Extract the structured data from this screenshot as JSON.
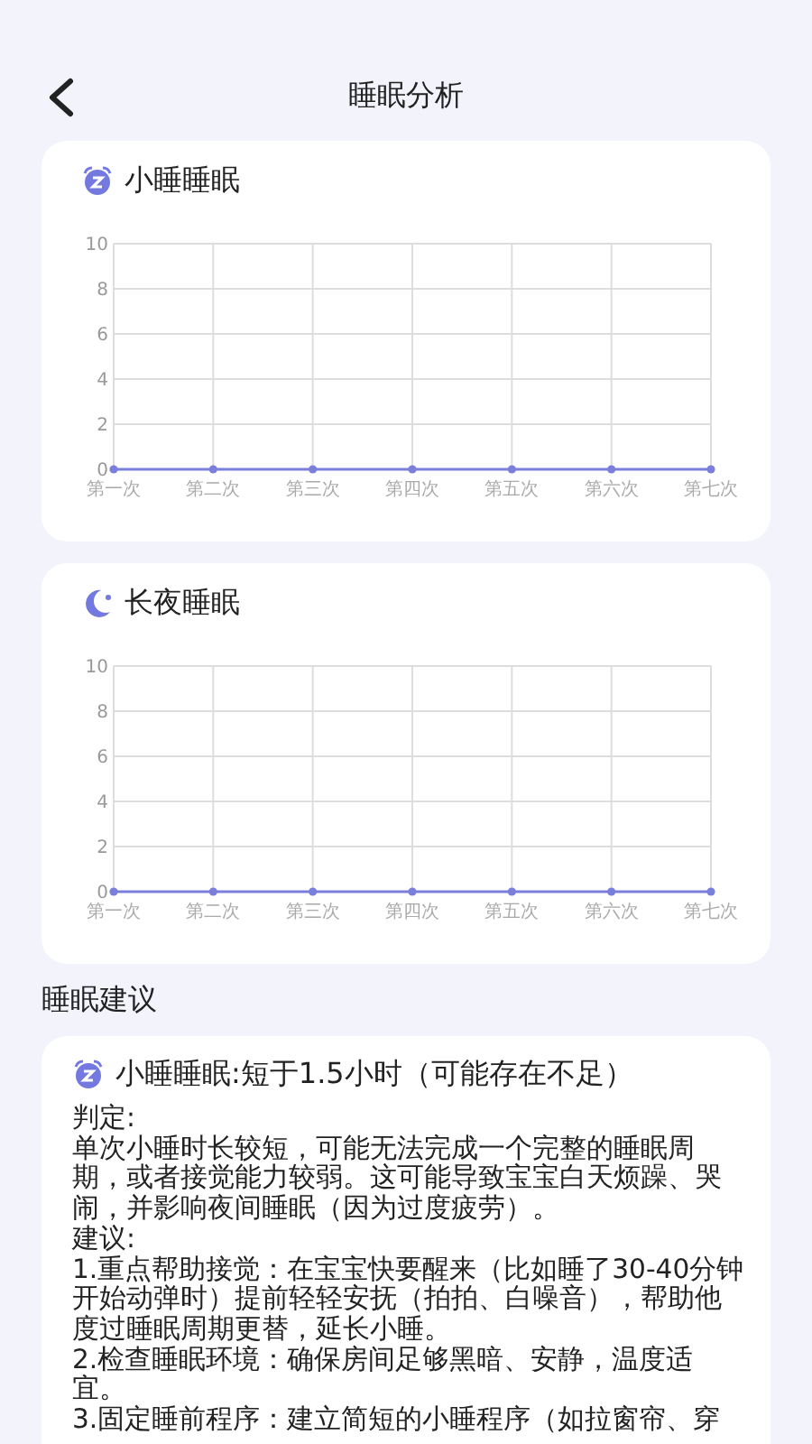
{
  "header": {
    "title": "睡眠分析"
  },
  "charts": [
    {
      "kind": "nap",
      "title": "小睡睡眠",
      "chart_data": {
        "type": "line",
        "categories": [
          "第一次",
          "第二次",
          "第三次",
          "第四次",
          "第五次",
          "第六次",
          "第七次"
        ],
        "series": [
          {
            "color": "#7b7fdc",
            "marker": true,
            "values": [
              0,
              0,
              0,
              0,
              0,
              0,
              0
            ]
          }
        ],
        "grid": true,
        "ylim": [
          0,
          10
        ],
        "yticks": [
          0,
          2,
          4,
          6,
          8,
          10
        ]
      }
    },
    {
      "kind": "night",
      "title": "长夜睡眠",
      "chart_data": {
        "type": "line",
        "categories": [
          "第一次",
          "第二次",
          "第三次",
          "第四次",
          "第五次",
          "第六次",
          "第七次"
        ],
        "series": [
          {
            "color": "#7b7fdc",
            "marker": true,
            "values": [
              0,
              0,
              0,
              0,
              0,
              0,
              0
            ]
          }
        ],
        "grid": true,
        "ylim": [
          0,
          10
        ],
        "yticks": [
          0,
          2,
          4,
          6,
          8,
          10
        ]
      }
    }
  ],
  "advice": {
    "heading": "睡眠建议",
    "card": {
      "kind": "nap",
      "title": "小睡睡眠:短于1.5小时（可能存在不足）",
      "lines": [
        "判定:",
        "单次小睡时长较短，可能无法完成一个完整的睡眠周期，或者接觉能力较弱。这可能导致宝宝白天烦躁、哭闹，并影响夜间睡眠（因为过度疲劳）。",
        "建议:",
        "1.重点帮助接觉：在宝宝快要醒来（比如睡了30-40分钟开始动弹时）提前轻轻安抚（拍拍、白噪音），帮助他度过睡眠周期更替，延长小睡。",
        "2.检查睡眠环境：确保房间足够黑暗、安静，温度适宜。",
        "3.固定睡前程序：建立简短的小睡程序（如拉窗帘、穿"
      ]
    }
  }
}
